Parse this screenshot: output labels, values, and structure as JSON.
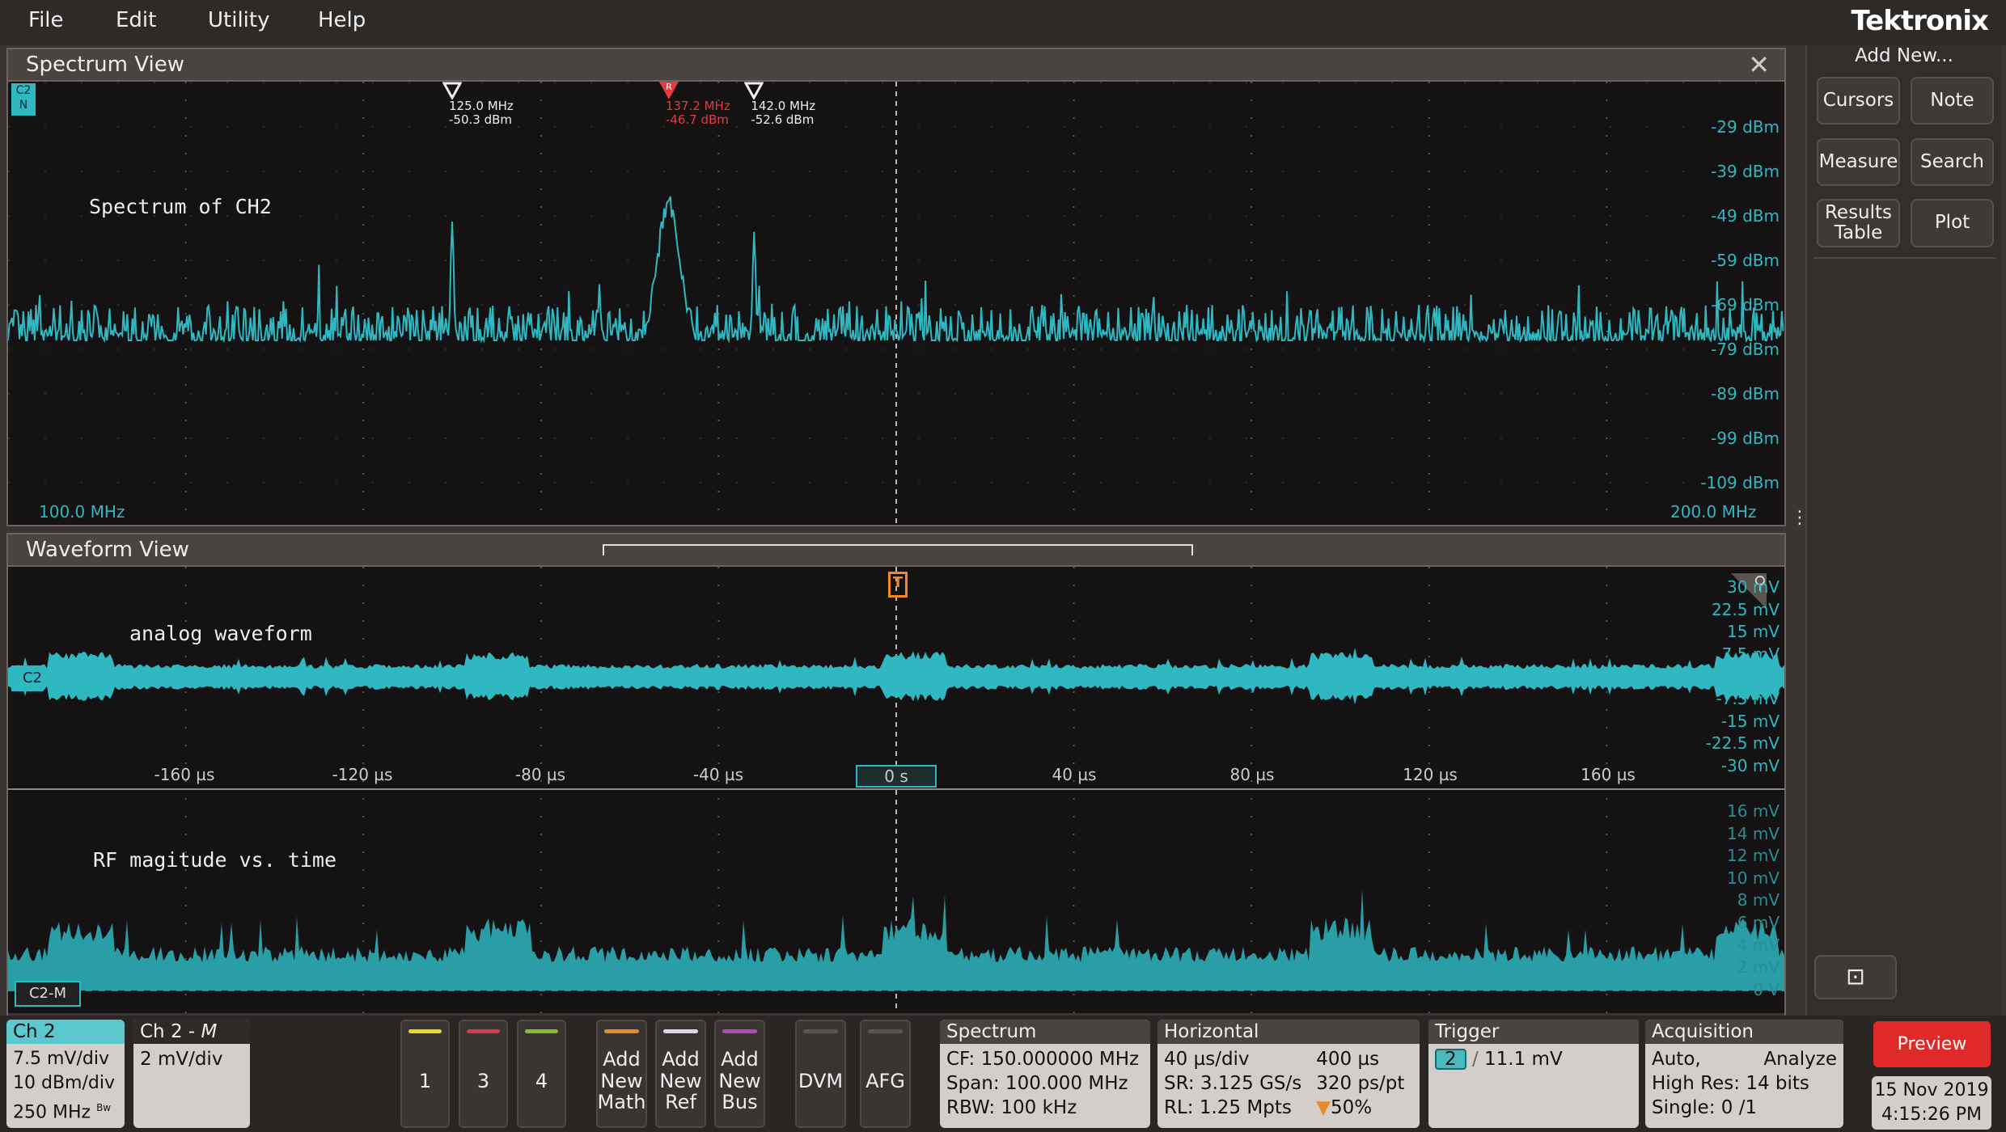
{
  "menu": {
    "items": [
      "File",
      "Edit",
      "Utility",
      "Help"
    ],
    "logo": "Tektronix"
  },
  "spectrum_view": {
    "title": "Spectrum View",
    "channel_badge": "C2",
    "channel_badge_sub": "N",
    "label": "Spectrum of CH2",
    "x_start": "100.0 MHz",
    "x_end": "200.0 MHz",
    "y_labels": [
      "-29 dBm",
      "-39 dBm",
      "-49 dBm",
      "-59 dBm",
      "-69 dBm",
      "-79 dBm",
      "-89 dBm",
      "-99 dBm",
      "-109 dBm"
    ],
    "markers": [
      {
        "freq": "125.0 MHz",
        "level": "-50.3 dBm",
        "ref": false,
        "mhz": 125,
        "dbm": -50.3
      },
      {
        "freq": "137.2 MHz",
        "level": "-46.7 dBm",
        "ref": true,
        "ref_label": "R",
        "mhz": 137.2,
        "dbm": -46.7
      },
      {
        "freq": "142.0 MHz",
        "level": "-52.6 dBm",
        "ref": false,
        "mhz": 142,
        "dbm": -52.6
      }
    ],
    "trace_color": "#2fb8c2"
  },
  "waveform_view": {
    "title": "Waveform View",
    "trigger_label": "T",
    "analog": {
      "label": "analog waveform",
      "badge": "C2",
      "y_labels": [
        "30 mV",
        "22.5 mV",
        "15 mV",
        "7.5 mV",
        "0 V",
        "-7.5 mV",
        "-15 mV",
        "-22.5 mV",
        "-30 mV"
      ]
    },
    "time_labels": [
      "-160 µs",
      "-120 µs",
      "-80 µs",
      "-40 µs",
      "0 s",
      "40 µs",
      "80 µs",
      "120 µs",
      "160 µs"
    ],
    "rf": {
      "label": "RF magitude vs. time",
      "badge": "C2-M",
      "y_labels": [
        "16 mV",
        "14 mV",
        "12 mV",
        "10 mV",
        "8 mV",
        "6 mV",
        "4 mV",
        "2 mV",
        "0 V"
      ]
    }
  },
  "right_panel": {
    "title": "Add New...",
    "buttons": [
      "Cursors",
      "Note",
      "Measure",
      "Search",
      "Results Table",
      "Plot"
    ]
  },
  "bottom": {
    "ch2": {
      "title": "Ch 2",
      "lines": [
        "7.5 mV/div",
        "10 dBm/div",
        "250 MHz"
      ],
      "bw": "Bw"
    },
    "ch2m": {
      "title": "Ch 2 - ",
      "title_m": "M",
      "lines": [
        "2 mV/div"
      ]
    },
    "channels": [
      {
        "label": "1",
        "color": "#e8d820"
      },
      {
        "label": "3",
        "color": "#d83a4a"
      },
      {
        "label": "4",
        "color": "#7cc030"
      }
    ],
    "add": [
      {
        "label": "Add New Math",
        "color": "#e88a2a"
      },
      {
        "label": "Add New Ref",
        "color": "#d8d8e8"
      },
      {
        "label": "Add New Bus",
        "color": "#b04ab8"
      }
    ],
    "tools": [
      "DVM",
      "AFG"
    ],
    "spectrum": {
      "title": "Spectrum",
      "lines": [
        "CF: 150.000000 MHz",
        "Span: 100.000 MHz",
        "RBW: 100 kHz"
      ]
    },
    "horizontal": {
      "title": "Horizontal",
      "left": [
        "40 µs/div",
        "SR: 3.125 GS/s",
        "RL: 1.25 Mpts"
      ],
      "right": [
        "400 µs",
        "320 ps/pt",
        "50%"
      ]
    },
    "trigger": {
      "title": "Trigger",
      "source": "2",
      "level": "11.1 mV"
    },
    "acquisition": {
      "title": "Acquisition",
      "lines": [
        "Auto,",
        "High Res: 14 bits",
        "Single: 0 /1"
      ],
      "mode": "Analyze"
    },
    "preview": "Preview",
    "date": "15 Nov 2019",
    "time": "4:15:26 PM"
  }
}
